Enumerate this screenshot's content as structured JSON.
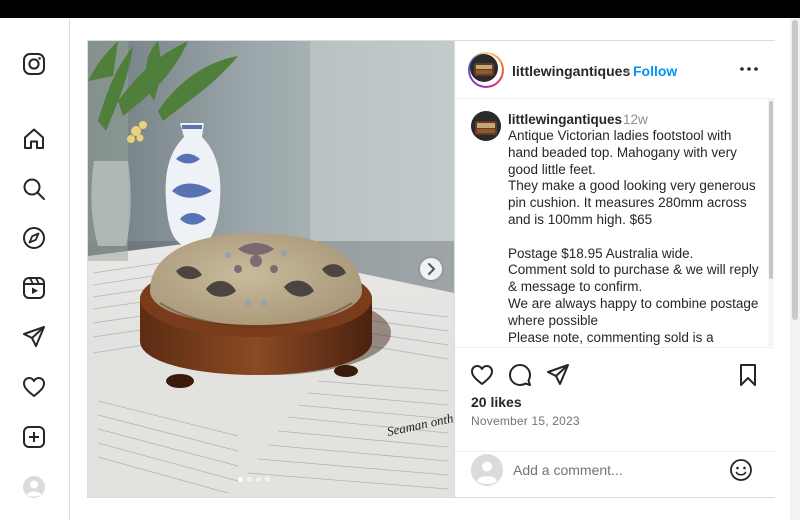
{
  "window": {
    "top_bar_color": "#000000"
  },
  "nav": {
    "items": [
      {
        "icon": "instagram-logo-icon"
      },
      {
        "icon": "home-icon"
      },
      {
        "icon": "search-icon"
      },
      {
        "icon": "explore-compass-icon"
      },
      {
        "icon": "reels-icon"
      },
      {
        "icon": "direct-messages-icon"
      },
      {
        "icon": "notifications-heart-icon"
      },
      {
        "icon": "create-plus-icon"
      },
      {
        "icon": "profile-avatar-icon"
      }
    ]
  },
  "post": {
    "header": {
      "username": "littlewingantiques",
      "separator": "•",
      "follow_label": "Follow",
      "more_icon": "more-options-icon"
    },
    "photo": {
      "subject": "beaded footstool on mahogany base, blue and white vase, handwritten letter pages",
      "carousel_slide": 1,
      "carousel_total": 4,
      "next_icon": "chevron-right-icon"
    },
    "caption": {
      "username": "littlewingantiques",
      "age": "12w",
      "lines": [
        "Antique Victorian ladies footstool with",
        "hand beaded top. Mahogany with very",
        "good little feet.",
        "They make a good looking very generous",
        "pin cushion. It measures 280mm across",
        "and is 100mm high. $65",
        "",
        "Postage $18.95 Australia wide.",
        "Comment sold to purchase & we will reply",
        "& message to confirm.",
        "We are always happy to combine postage",
        "where possible",
        "Please note, commenting sold is a"
      ]
    },
    "actions": {
      "like_icon": "heart-icon",
      "comment_icon": "comment-icon",
      "share_icon": "share-icon",
      "save_icon": "bookmark-icon"
    },
    "likes": "20 likes",
    "date": "November 15, 2023",
    "comment_box": {
      "placeholder": "Add a comment...",
      "emoji_icon": "emoji-smile-icon"
    }
  },
  "colors": {
    "accent": "#0095f6",
    "text": "#262626",
    "muted": "#737373",
    "border": "#dbdbdb"
  }
}
